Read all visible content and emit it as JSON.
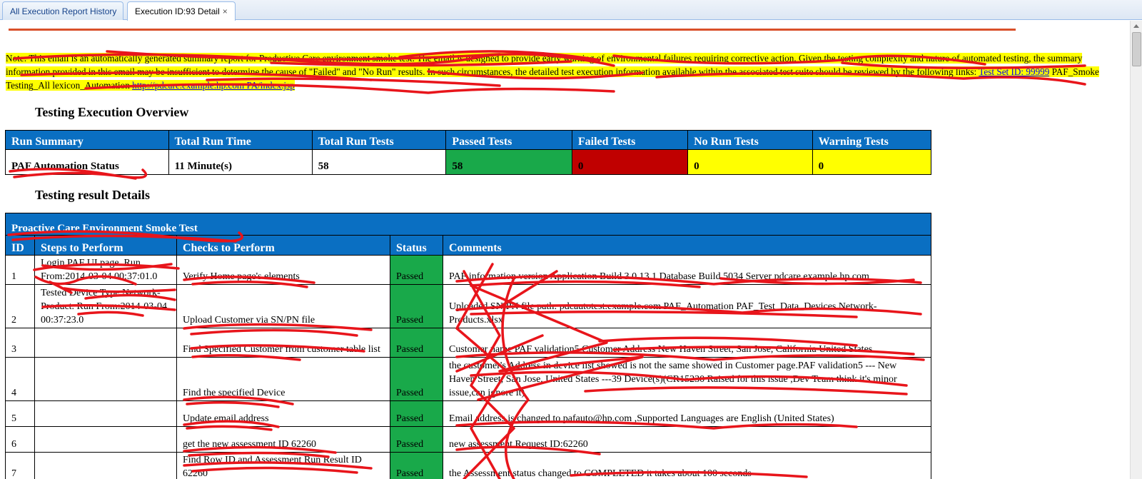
{
  "tabs": [
    {
      "label": "All Execution Report History"
    },
    {
      "label": "Execution ID:93 Detail",
      "close": "×"
    }
  ],
  "note": {
    "text": "Note: This email is an automatically generated summary report for Productive Care environment smoke test. The email is designed to provide early warning of environmental failures requiring corrective action. Given the testing complexity and nature of automated testing, the summary information provided in this email may be insufficient to determine the cause of \"Failed\" and \"No Run\" results. In such circumstances, the detailed test execution information available within the associated test suite should be reviewed by the following links: ",
    "link1": "Test Set ID: 99999",
    "middle": " PAF_Smoke Testing_All lexicon_Automation ",
    "link2": "http://pdcare.example.hp.com PA/index.jsp"
  },
  "overview": {
    "title": "Testing Execution Overview",
    "headers": [
      "Run Summary",
      "Total Run Time",
      "Total Run Tests",
      "Passed Tests",
      "Failed Tests",
      "No Run Tests",
      "Warning Tests"
    ],
    "values": [
      "PAF Automation Status",
      "11 Minute(s)",
      "58",
      "58",
      "0",
      "0",
      "0"
    ]
  },
  "details": {
    "title": "Testing result Details",
    "suite_name": "Proactive Care Environment Smoke Test",
    "headers": [
      "ID",
      "Steps to Perform",
      "Checks to Perform",
      "Status",
      "Comments"
    ],
    "rows": [
      {
        "id": "1",
        "step": "Login PAF UI page. Run From:2014-03-04 00:37:01.0",
        "check": "Verify Home page's elements",
        "status": "Passed",
        "comment": "PAF information version Application Build 3.0.13.1 Database Build 5034 Server pdcare.example.hp.com"
      },
      {
        "id": "2",
        "step": "Tested Device Type Network-Product. Run From:2014-03-04 00:37:23.0",
        "check": "Upload Customer via SN/PN file",
        "status": "Passed",
        "comment": "Uploaded SN/PN file path: pdcautotest.example.com PAF_Automation PAF_Test_Data_Devices Network-Products.xlsx"
      },
      {
        "id": "3",
        "step": "",
        "check": "Find Specified Customer from customer table list",
        "status": "Passed",
        "comment": "Customer name PAF validation5 Customer Address New Haven Street, San Jose, California United States"
      },
      {
        "id": "4",
        "step": "",
        "check": "Find the specified Device",
        "status": "Passed",
        "comment": "the customer's Address in device list showed is not the same showed in Customer page.PAF validation5 --- New Haven Street, San Jose, United States ---39 Device(s)(CR15230 Raised for this issue ,Dev Team think it's minor issue,can ignore it)"
      },
      {
        "id": "5",
        "step": "",
        "check": "Update email address",
        "status": "Passed",
        "comment": "Email address is changed to pafauto@hp.com ,Supported Languages are English (United States)"
      },
      {
        "id": "6",
        "step": "",
        "check": "get the new assessment ID 62260",
        "status": "Passed",
        "comment": "new assessment Request ID:62260"
      },
      {
        "id": "7",
        "step": "",
        "check": "Find Row ID and Assessment Run Result ID 62260",
        "status": "Passed",
        "comment": "the Assessment status changed to COMPLETED it takes about 100 seconds"
      }
    ]
  },
  "colors": {
    "header_blue": "#0a6fc2",
    "pass_green": "#19a94a",
    "fail_red": "#c00000",
    "warn_yellow": "#ffff00",
    "rule_orange": "#d9502a"
  }
}
